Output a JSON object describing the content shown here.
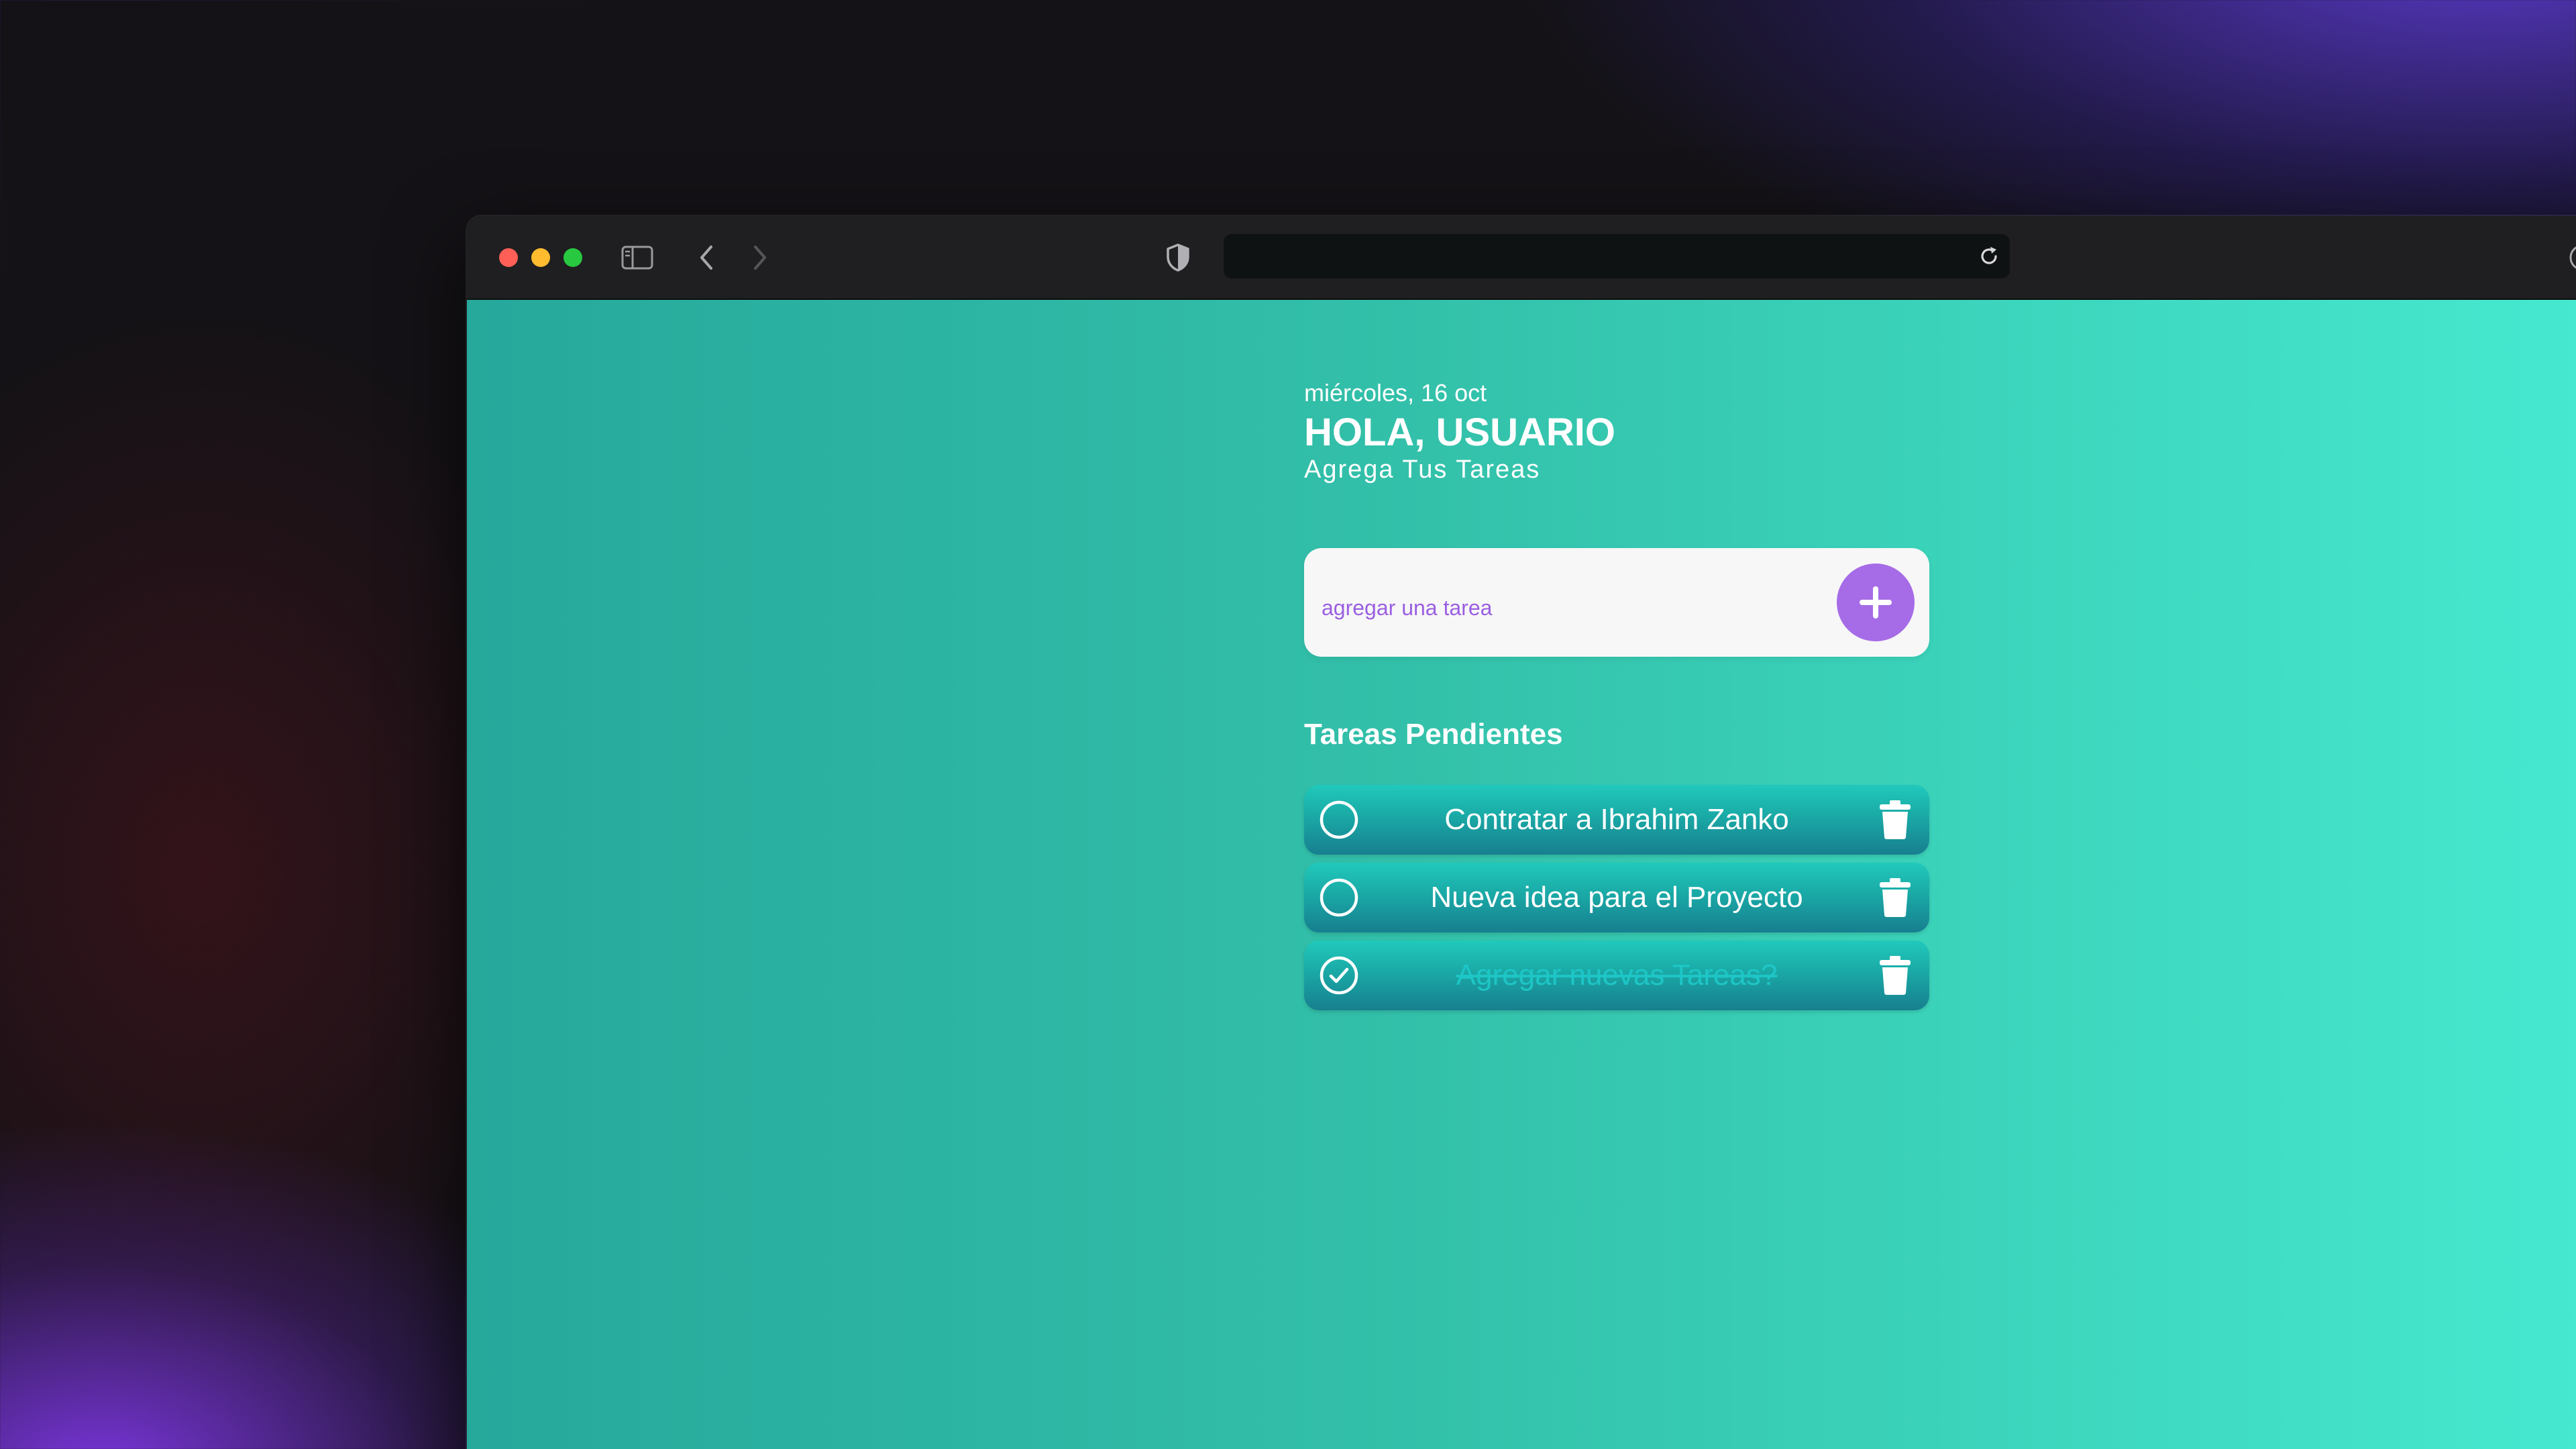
{
  "browser": {
    "address_value": "",
    "icons": {
      "sidebar": "sidebar-icon",
      "back": "chevron-left-icon",
      "forward": "chevron-right-icon",
      "privacy": "shield-icon",
      "reload": "reload-icon",
      "download": "download-icon"
    }
  },
  "header": {
    "date": "miércoles, 16 oct",
    "greeting": "HOLA, USUARIO",
    "subtitle": "Agrega Tus Tareas"
  },
  "form": {
    "placeholder": "agregar una tarea",
    "value": "",
    "add_icon": "plus-icon"
  },
  "tasks": {
    "section_title": "Tareas Pendientes",
    "items": [
      {
        "text": "Contratar a Ibrahim Zanko",
        "done": false
      },
      {
        "text": "Nueva idea para el Proyecto",
        "done": false
      },
      {
        "text": "Agregar nuevas Tareas?",
        "done": true
      }
    ]
  },
  "colors": {
    "accent_purple": "#a66be6",
    "background_start": "#26a89b",
    "background_end": "#46ead0",
    "task_gradient_top": "#21c9bb",
    "task_gradient_bottom": "#177f8f",
    "done_text": "#1ec6c6"
  }
}
